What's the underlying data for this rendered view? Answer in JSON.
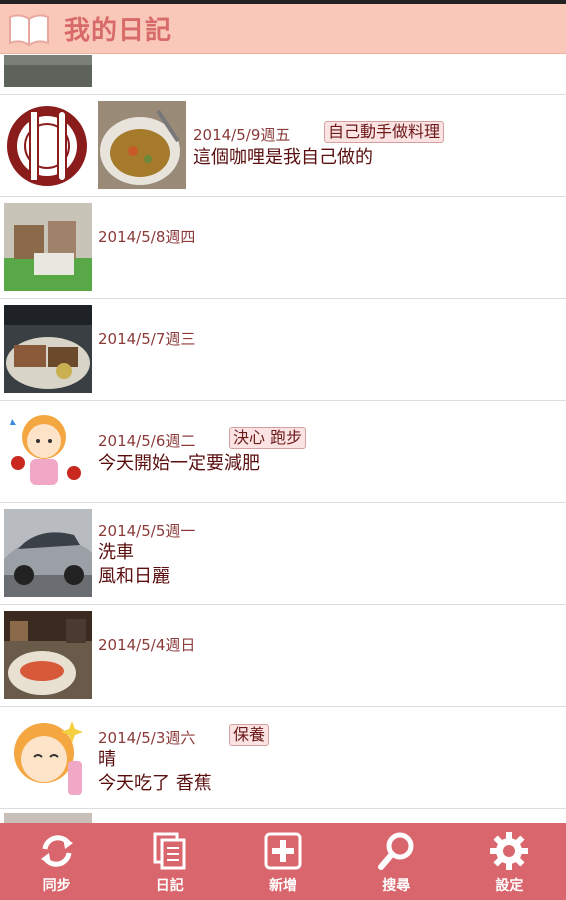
{
  "app": {
    "title": "我的日記"
  },
  "entries": [
    {
      "date": "2014/5/9週五",
      "tag": "自己動手做料理",
      "lines": [
        "這個咖哩是我自己做的"
      ]
    },
    {
      "date": "2014/5/8週四"
    },
    {
      "date": "2014/5/7週三"
    },
    {
      "date": "2014/5/6週二",
      "tag": "決心 跑步",
      "lines": [
        "今天開始一定要減肥"
      ]
    },
    {
      "date": "2014/5/5週一",
      "lines": [
        "洗車",
        "風和日麗"
      ]
    },
    {
      "date": "2014/5/4週日"
    },
    {
      "date": "2014/5/3週六",
      "tag": "保養",
      "lines": [
        "晴",
        "今天吃了 香蕉"
      ]
    }
  ],
  "tabs": [
    {
      "label": "同步",
      "icon": "sync-icon"
    },
    {
      "label": "日記",
      "icon": "diary-icon"
    },
    {
      "label": "新增",
      "icon": "add-icon"
    },
    {
      "label": "搜尋",
      "icon": "search-icon"
    },
    {
      "label": "設定",
      "icon": "settings-icon"
    }
  ],
  "colors": {
    "header_bg": "#f9c8b8",
    "title": "#d96a6a",
    "tabbar_bg": "#d9666d",
    "text": "#5a0e0e"
  }
}
